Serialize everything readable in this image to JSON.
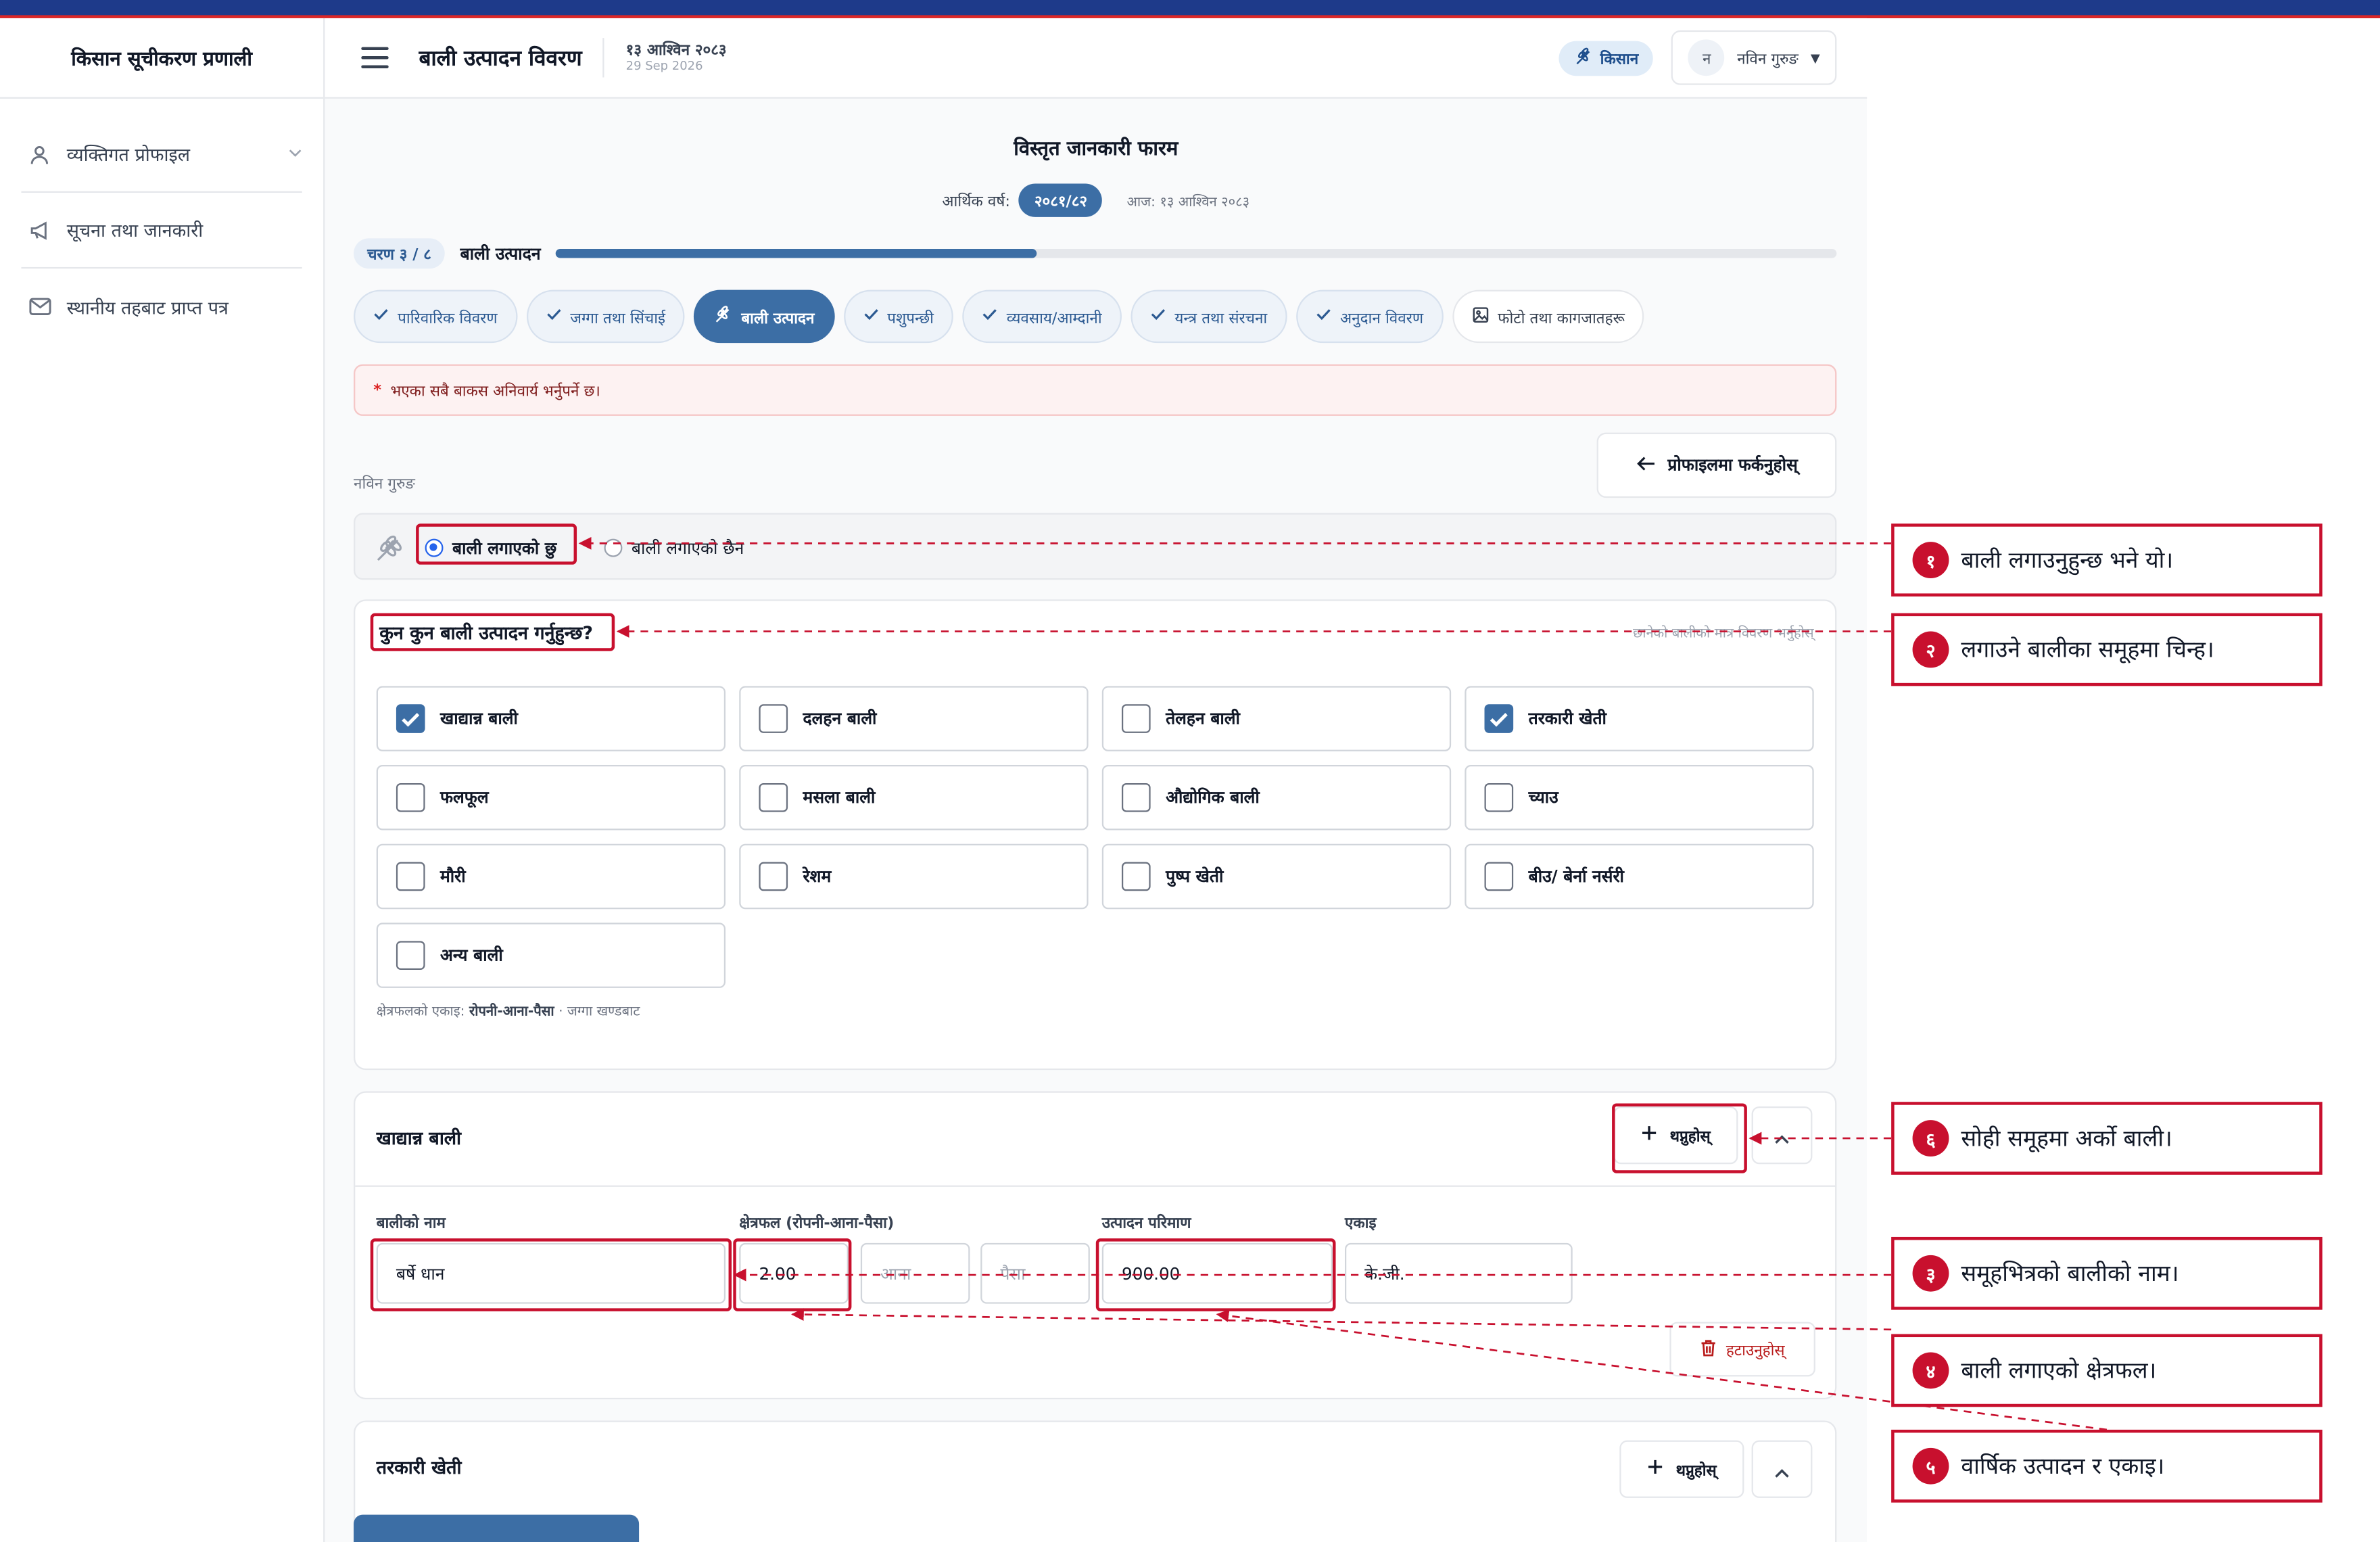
{
  "app": {
    "brand": "किसान सूचीकरण प्रणाली"
  },
  "sidebar": {
    "items": [
      {
        "label": "व्यक्तिगत प्रोफाइल",
        "icon": "user-icon"
      },
      {
        "label": "सूचना तथा जानकारी",
        "icon": "megaphone-icon"
      },
      {
        "label": "स्थानीय तहबाट प्राप्त पत्र",
        "icon": "mail-icon"
      }
    ]
  },
  "header": {
    "title": "बाली उत्पादन विवरण",
    "date_np": "१३ आश्विन २०८३",
    "date_en": "29 Sep 2026",
    "role": "किसान",
    "avatar_initial": "न",
    "user_name": "नविन गुरुङ"
  },
  "form": {
    "title": "विस्तृत जानकारी फारम",
    "fy_label": "आर्थिक वर्ष:",
    "fy_value": "२०८१/८२",
    "today": "आज: १३ आश्विन २०८३",
    "step_badge": "चरण ३ / ८",
    "step_name": "बाली उत्पादन",
    "progress_fraction": 0.375
  },
  "tabs": [
    {
      "label": "पारिवारिक विवरण",
      "state": "done"
    },
    {
      "label": "जग्गा तथा सिंचाई",
      "state": "done"
    },
    {
      "label": "बाली उत्पादन",
      "state": "active"
    },
    {
      "label": "पशुपन्छी",
      "state": "done"
    },
    {
      "label": "व्यवसाय/आम्दानी",
      "state": "done"
    },
    {
      "label": "यन्त्र तथा संरचना",
      "state": "done"
    },
    {
      "label": "अनुदान विवरण",
      "state": "done"
    },
    {
      "label": "फोटो तथा कागजातहरू",
      "state": "pending"
    }
  ],
  "alert": {
    "star": "*",
    "text": "भएका सबै बाकस अनिवार्य भर्नुपर्ने छ।"
  },
  "back_button": "प्रोफाइलमा फर्कनुहोस्",
  "farmer_name": "नविन गुरुङ",
  "crop_status": {
    "yes": "बाली लगाएको छु",
    "no": "बाली लगाएको छैन",
    "selected": "yes"
  },
  "crops": {
    "question": "कुन कुन बाली उत्पादन गर्नुहुन्छ?",
    "hint": "छानेको बालीको मात्र विवरण भर्नुहोस्",
    "groups": [
      {
        "label": "खाद्यान्न बाली",
        "checked": true
      },
      {
        "label": "दलहन बाली",
        "checked": false
      },
      {
        "label": "तेलहन बाली",
        "checked": false
      },
      {
        "label": "तरकारी खेती",
        "checked": true
      },
      {
        "label": "फलफूल",
        "checked": false
      },
      {
        "label": "मसला बाली",
        "checked": false
      },
      {
        "label": "औद्योगिक बाली",
        "checked": false
      },
      {
        "label": "च्याउ",
        "checked": false
      },
      {
        "label": "मौरी",
        "checked": false
      },
      {
        "label": "रेशम",
        "checked": false
      },
      {
        "label": "पुष्प खेती",
        "checked": false
      },
      {
        "label": "बीउ/ बेर्ना नर्सरी",
        "checked": false
      },
      {
        "label": "अन्य बाली",
        "checked": false
      }
    ],
    "area_unit_prefix": "क्षेत्रफलको एकाइ:",
    "area_unit_value": "रोपनी-आना-पैसा",
    "area_unit_suffix": "· जग्गा खण्डबाट"
  },
  "group_food": {
    "title": "खाद्यान्न बाली",
    "add_label": "थप्नुहोस्",
    "labels": {
      "name": "बालीको नाम",
      "area": "क्षेत्रफल (रोपनी-आना-पैसा)",
      "production": "उत्पादन परिमाण",
      "unit": "एकाइ"
    },
    "row": {
      "name": "बर्षे धान",
      "ropani": "2.00",
      "aana_ph": "आना",
      "paisa_ph": "पैसा",
      "production": "900.00",
      "unit": "के.जी."
    },
    "remove_label": "हटाउनुहोस्"
  },
  "group_veg": {
    "title": "तरकारी खेती",
    "add_label": "थप्नुहोस्"
  },
  "callouts": [
    {
      "num": "१",
      "text": "बाली लगाउनुहुन्छ भने यो।"
    },
    {
      "num": "२",
      "text": "लगाउने बालीका समूहमा चिन्ह।"
    },
    {
      "num": "६",
      "text": "सोही समूहमा अर्को बाली।"
    },
    {
      "num": "३",
      "text": "समूहभित्रको बालीको नाम।"
    },
    {
      "num": "४",
      "text": "बाली लगाएको क्षेत्रफल।"
    },
    {
      "num": "५",
      "text": "वार्षिक उत्पादन र एकाइ।"
    }
  ],
  "colors": {
    "primary": "#3c6ea5",
    "annotation": "#c8102e",
    "topbar": "#1e3a8a"
  }
}
